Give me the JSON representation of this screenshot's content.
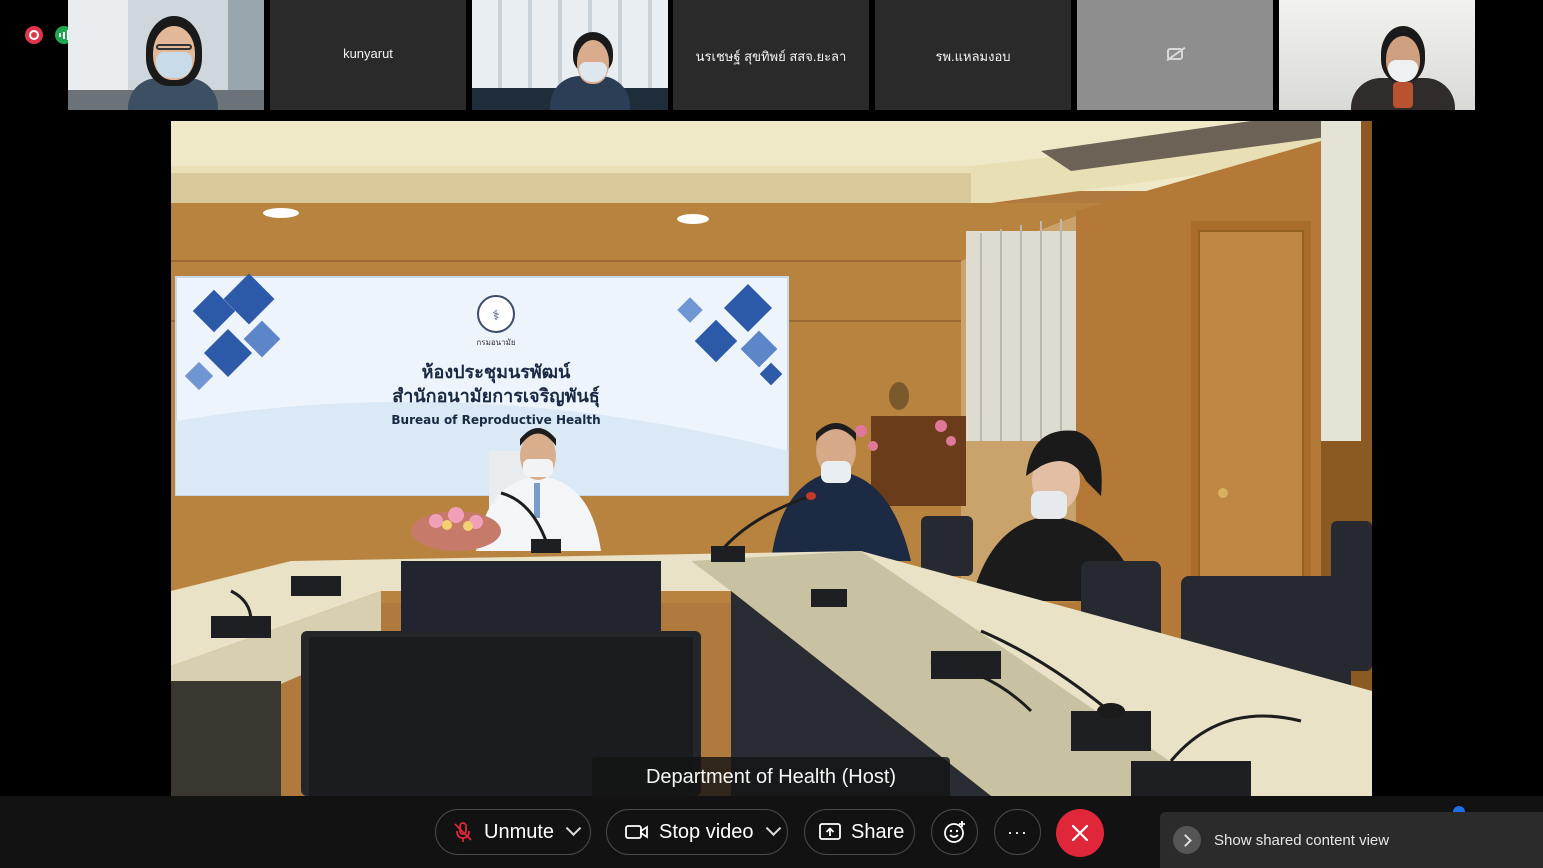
{
  "status": {
    "recording_icon": "recording-icon",
    "network_icon": "network-signal-icon"
  },
  "participants": [
    {
      "name": "",
      "video": true
    },
    {
      "name": "kunyarut",
      "video": false
    },
    {
      "name": "",
      "video": true
    },
    {
      "name": "นรเชษฐ์ สุขทิพย์ สสจ.ยะลา",
      "video": false
    },
    {
      "name": "รพ.แหลมงอบ",
      "video": false
    },
    {
      "name": "",
      "video": false,
      "icon": "camera-off-icon"
    },
    {
      "name": "",
      "video": true
    }
  ],
  "main_video": {
    "host_label": "Department of Health (Host)",
    "banner": {
      "line1": "ห้องประชุมนรพัฒน์",
      "line2": "สำนักอนามัยการเจริญพันธุ์",
      "line3": "Bureau of Reproductive Health",
      "logo_caption": "กรมอนามัย"
    }
  },
  "toolbar": {
    "unmute_label": "Unmute",
    "stop_video_label": "Stop video",
    "share_label": "Share",
    "reactions_icon": "reactions-icon",
    "more_label": "···",
    "leave_icon": "close-icon",
    "shared_content_label": "Show shared content view"
  },
  "colors": {
    "leave": "#e0273a",
    "recording": "#e0364a",
    "network": "#1fa84f",
    "toolbar_bg": "#121212"
  }
}
